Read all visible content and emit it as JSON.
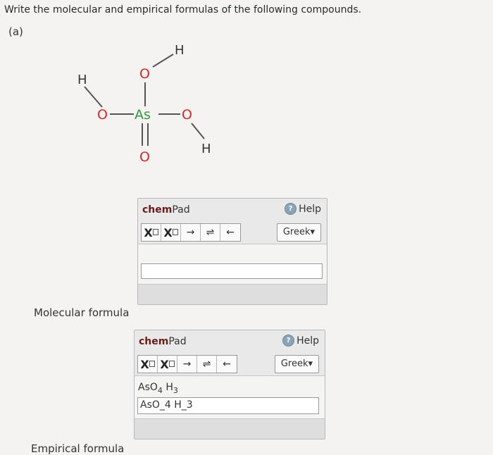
{
  "question": {
    "text": "Write the molecular and empirical formulas of the following compounds.",
    "part": "(a)"
  },
  "molecule": {
    "atoms": {
      "h_top": "H",
      "h_left": "H",
      "h_right": "H",
      "o_top": "O",
      "o_left": "O",
      "o_right": "O",
      "o_bottom": "O",
      "as": "As"
    },
    "colors": {
      "oxygen": "#d62a2a",
      "arsenic": "#2e9a3a",
      "hydrogen": "#333333",
      "bond": "#555555"
    }
  },
  "labels": {
    "molecular": "Molecular formula",
    "empirical": "Empirical formula"
  },
  "chempad1": {
    "title_bold": "chem",
    "title_rest": "Pad",
    "help": "Help",
    "tools": {
      "subscript": "X",
      "superscript": "X",
      "arrow": "→",
      "equilibrium": "⇌",
      "back_arrow": "←"
    },
    "greek": "Greek▾",
    "input_value": ""
  },
  "chempad2": {
    "title_bold": "chem",
    "title_rest": "Pad",
    "help": "Help",
    "tools": {
      "subscript": "X",
      "superscript": "X",
      "arrow": "→",
      "equilibrium": "⇌",
      "back_arrow": "←"
    },
    "greek": "Greek▾",
    "preview": {
      "as": "AsO",
      "sub1": "4",
      "h": " H",
      "sub2": "3"
    },
    "input_value": "AsO_4 H_3"
  }
}
